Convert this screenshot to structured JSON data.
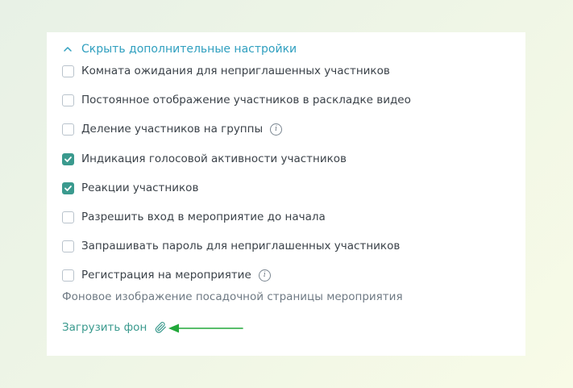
{
  "settings": {
    "toggle_label": "Скрыть дополнительные настройки",
    "options": [
      {
        "label": "Комната ожидания для неприглашенных участников",
        "checked": false,
        "info": false
      },
      {
        "label": "Постоянное отображение участников в раскладке видео",
        "checked": false,
        "info": false
      },
      {
        "label": "Деление участников на группы",
        "checked": false,
        "info": true
      },
      {
        "label": "Индикация голосовой активности участников",
        "checked": true,
        "info": false
      },
      {
        "label": "Реакции участников",
        "checked": true,
        "info": false
      },
      {
        "label": "Разрешить вход в мероприятие до начала",
        "checked": false,
        "info": false
      },
      {
        "label": "Запрашивать пароль для неприглашенных участников",
        "checked": false,
        "info": false
      },
      {
        "label": "Регистрация на мероприятие",
        "checked": false,
        "info": true
      }
    ],
    "info_glyph": "i",
    "background_title": "Фоновое изображение посадочной страницы мероприятия",
    "upload_label": "Загрузить фон"
  },
  "colors": {
    "accent": "#3a9a8e",
    "toggle_link": "#2f9fbf",
    "annotation_arrow": "#22a83a"
  },
  "icons": {
    "toggle": "chevron-up-icon",
    "upload": "paperclip-icon",
    "info": "info-icon",
    "annotation": "arrow-left-annotation"
  }
}
